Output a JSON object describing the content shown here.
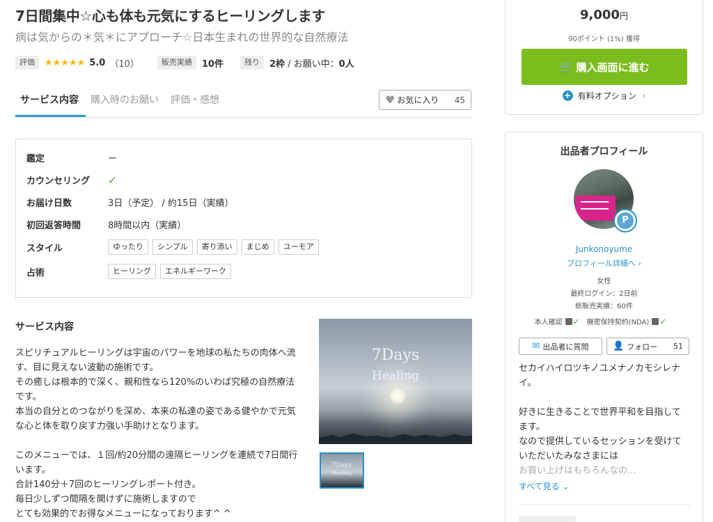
{
  "service": {
    "title": "7日間集中☆心も体も元気にするヒーリングします",
    "subtitle": "病は気からの＊気＊にアプローチ☆日本生まれの世界的な自然療法",
    "meta": {
      "rating_label": "評価",
      "stars": "★★★★★",
      "rating": "5.0",
      "review_count": "（10）",
      "sales_label": "販売実績",
      "sales_value": "10件",
      "remain_label": "残り",
      "remain_value": "2枠",
      "remain_rest": " / お願い中：",
      "remain_in_progress": "0人"
    }
  },
  "tabs": [
    {
      "label": "サービス内容"
    },
    {
      "label": "購入時のお願い"
    },
    {
      "label": "評価・感想"
    }
  ],
  "favorite": {
    "label": "お気に入り",
    "count": "45"
  },
  "spec": {
    "rows": [
      {
        "label": "鑑定",
        "value": "ー"
      },
      {
        "label": "カウンセリング",
        "value": "✓"
      },
      {
        "label": "お届け日数",
        "value": "3日（予定） / 約15日（実績）"
      },
      {
        "label": "初回返答時間",
        "value": "8時間以内（実績）"
      },
      {
        "label": "スタイル",
        "chips": [
          "ゆったり",
          "シンプル",
          "寄り添い",
          "まじめ",
          "ユーモア"
        ]
      },
      {
        "label": "占術",
        "chips": [
          "ヒーリング",
          "エネルギーワーク"
        ]
      }
    ]
  },
  "description": {
    "heading": "サービス内容",
    "lines": [
      "スピリチュアルヒーリングは宇宙のパワーを地球の私たちの肉体へ流",
      "す、目に見えない波動の施術です。",
      "その癒しは根本的で深く、親和性なら120%のいわば究極の自然療法",
      "です。",
      "本当の自分とのつながりを深め、本来の私達の姿である健やかで元気",
      "な心と体を取り戻す力強い手助けとなります。",
      "",
      "このメニューでは、１回/約20分間の遠隔ヒーリングを連続で7日間行",
      "います。",
      "合計140分＋7回のヒーリングレポート付き。",
      "毎日少しずつ間隔を開けずに施術しますので",
      "とても効果的でお得なメニューになっております^ ^"
    ]
  },
  "image": {
    "line1": "7Days",
    "line2": "Healing"
  },
  "purchase": {
    "price": "9,000",
    "currency": "円",
    "points": "90ポイント (1%) 獲得",
    "buy_label": "購入画面に進む",
    "option_label": "有料オプション"
  },
  "profile": {
    "heading": "出品者プロフィール",
    "username": "Junkonoyume",
    "detail_link": "プロフィール詳細へ",
    "gender": "女性",
    "last_login": "最終ログイン：2日前",
    "total_sales": "総販売実績：60件",
    "identity_label": "本人確認",
    "nda_label": "機密保持契約(NDA)",
    "question_label": "出品者に質問",
    "follow_label": "フォロー",
    "follow_count": "51",
    "bio": [
      "セカイハイロツキノユメナノカモシレナ",
      "イ。",
      "",
      "好きに生きることで世界平和を目指して",
      "ます。",
      "なので提供しているセッションを受けて",
      "いただいたみなさまには",
      "お買い上げはもちろんなの..."
    ],
    "see_all": "すべて見る"
  },
  "colors": {
    "accent": "#1b9fc8",
    "buy": "#7cbd1e",
    "link": "#2a8fc8",
    "star": "#f5b800"
  }
}
